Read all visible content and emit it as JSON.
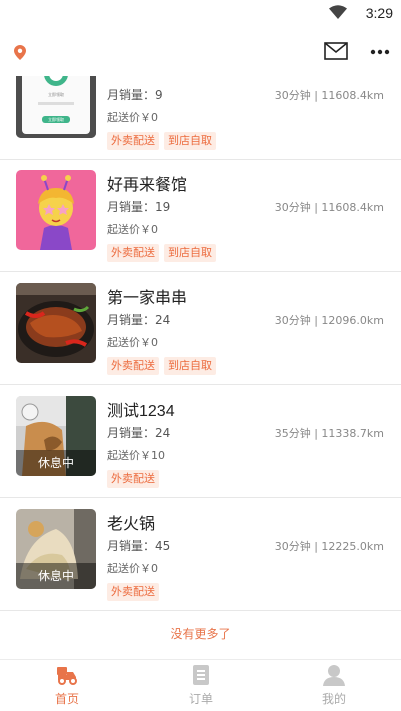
{
  "status_bar": {
    "time": "3:29"
  },
  "shops": [
    {
      "name": "",
      "monthly_sales": "月销量：9",
      "distance": "30分钟 | 11608.4km",
      "min_price": "起送价￥0",
      "tags": [
        "外卖配送",
        "到店自取"
      ],
      "status": ""
    },
    {
      "name": "好再来餐馆",
      "monthly_sales": "月销量：19",
      "distance": "30分钟 | 11608.4km",
      "min_price": "起送价￥0",
      "tags": [
        "外卖配送",
        "到店自取"
      ],
      "status": ""
    },
    {
      "name": "第一家串串",
      "monthly_sales": "月销量：24",
      "distance": "30分钟 | 12096.0km",
      "min_price": "起送价￥0",
      "tags": [
        "外卖配送",
        "到店自取"
      ],
      "status": ""
    },
    {
      "name": "测试1234",
      "monthly_sales": "月销量：24",
      "distance": "35分钟 | 11338.7km",
      "min_price": "起送价￥10",
      "tags": [
        "外卖配送"
      ],
      "status": "休息中"
    },
    {
      "name": "老火锅",
      "monthly_sales": "月销量：45",
      "distance": "30分钟 | 12225.0km",
      "min_price": "起送价￥0",
      "tags": [
        "外卖配送"
      ],
      "status": "休息中"
    }
  ],
  "thumb_text": {
    "line1": "立即领取",
    "button": "立即领取"
  },
  "footer": {
    "no_more": "没有更多了"
  },
  "tabbar": [
    {
      "label": "首页",
      "icon": "delivery-scooter-icon",
      "active": true
    },
    {
      "label": "订单",
      "icon": "order-list-icon",
      "active": false
    },
    {
      "label": "我的",
      "icon": "user-profile-icon",
      "active": false
    }
  ],
  "colors": {
    "accent": "#e8744a",
    "tag_bg": "#fdece4",
    "tag_text": "#ec6b3e"
  }
}
